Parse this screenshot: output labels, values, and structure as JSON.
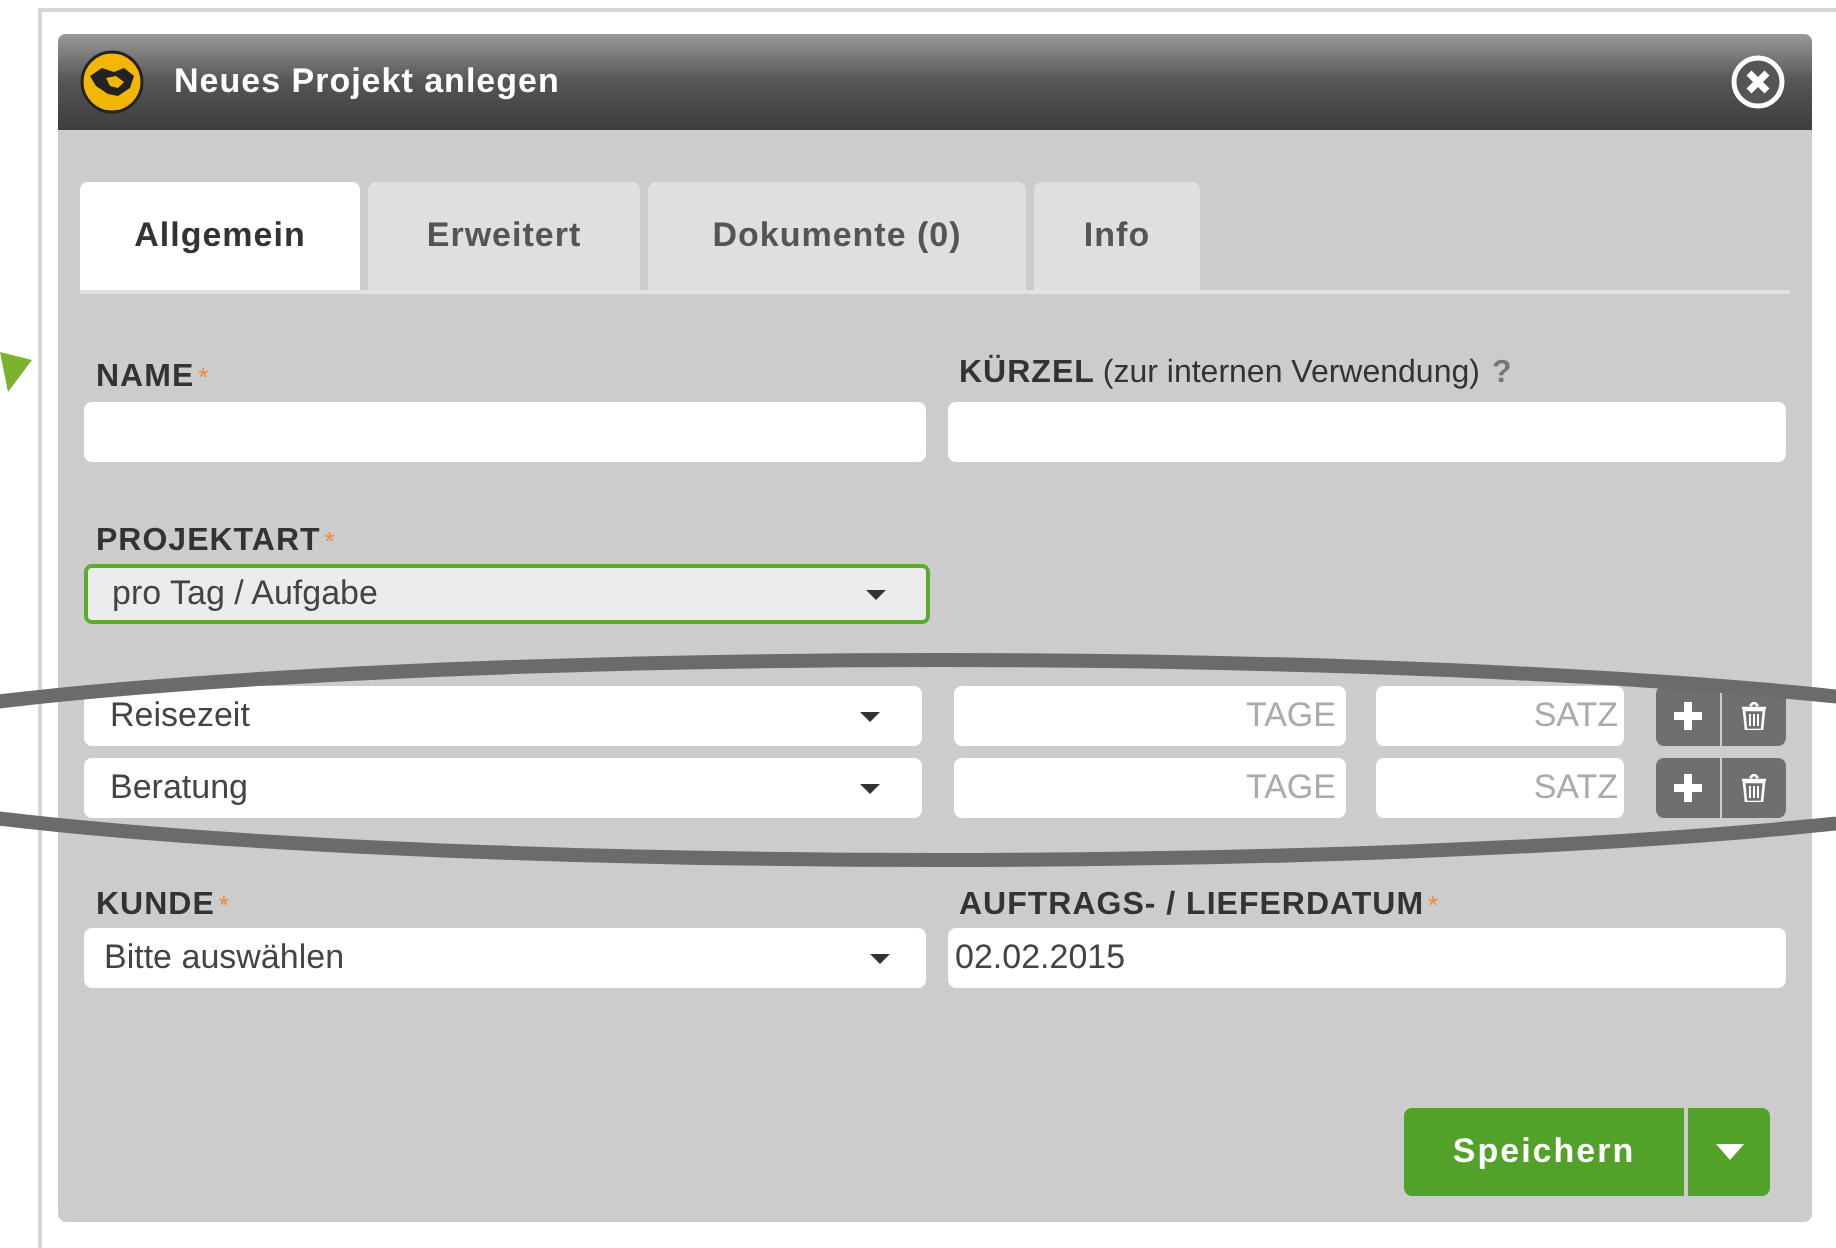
{
  "dialog": {
    "title": "Neues Projekt anlegen"
  },
  "tabs": [
    {
      "label": "Allgemein",
      "selected": true
    },
    {
      "label": "Erweitert",
      "selected": false
    },
    {
      "label": "Dokumente (0)",
      "selected": false
    },
    {
      "label": "Info",
      "selected": false
    }
  ],
  "name_field": {
    "label": "NAME",
    "required_mark": "*"
  },
  "kuerzel_field": {
    "label": "KÜRZEL",
    "note": "(zur internen Verwendung)",
    "help": "?"
  },
  "projektart_field": {
    "label": "PROJEKTART",
    "required_mark": "*",
    "value": "pro Tag / Aufgabe",
    "focused": true
  },
  "positions": [
    {
      "service": "Reisezeit",
      "days_placeholder": "TAGE",
      "rate_placeholder": "SATZ"
    },
    {
      "service": "Beratung",
      "days_placeholder": "TAGE",
      "rate_placeholder": "SATZ"
    }
  ],
  "kunde_field": {
    "label": "KUNDE",
    "required_mark": "*",
    "value": "Bitte auswählen"
  },
  "date_field": {
    "label": "AUFTRAGS- / LIEFERDATUM",
    "required_mark": "*",
    "value": "02.02.2015"
  },
  "save_button": {
    "label": "Speichern"
  }
}
